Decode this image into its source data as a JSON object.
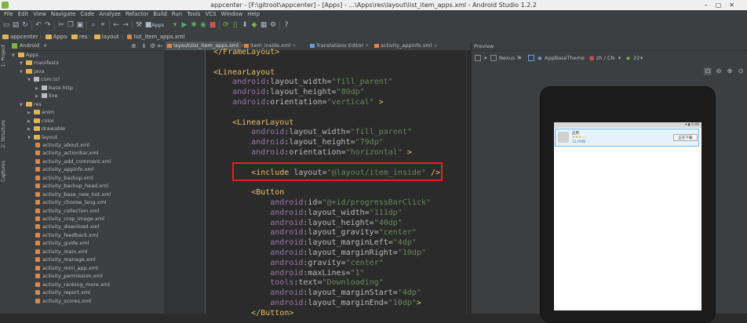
{
  "window": {
    "title": "appcenter - [F:\\gitroot\\appcenter] - [Apps] - ...\\Apps\\res\\layout\\list_item_apps.xml - Android Studio 1.2.2"
  },
  "menu": [
    "File",
    "Edit",
    "View",
    "Navigate",
    "Code",
    "Analyze",
    "Refactor",
    "Build",
    "Run",
    "Tools",
    "VCS",
    "Window",
    "Help"
  ],
  "toolbar": {
    "run_config": "Apps",
    "help": "?"
  },
  "breadcrumb": [
    "appcenter",
    "Apps",
    "res",
    "layout",
    "list_item_apps.xml"
  ],
  "left_strip": {
    "project": "1: Project",
    "structure": "2: Structure",
    "captures": "Captures"
  },
  "project_panel": {
    "view_mode": "Android",
    "tree": [
      {
        "label": "Apps",
        "level": 0,
        "type": "module"
      },
      {
        "label": "manifests",
        "level": 1,
        "type": "folder"
      },
      {
        "label": "java",
        "level": 1,
        "type": "folder"
      },
      {
        "label": "com.tcl",
        "level": 2,
        "type": "package"
      },
      {
        "label": "base.http",
        "level": 3,
        "type": "package"
      },
      {
        "label": "live",
        "level": 3,
        "type": "package"
      },
      {
        "label": "res",
        "level": 1,
        "type": "folder"
      },
      {
        "label": "anim",
        "level": 2,
        "type": "folder"
      },
      {
        "label": "color",
        "level": 2,
        "type": "folder"
      },
      {
        "label": "drawable",
        "level": 2,
        "type": "folder"
      },
      {
        "label": "layout",
        "level": 2,
        "type": "folder"
      },
      {
        "label": "activity_about.xml",
        "level": 3,
        "type": "xml"
      },
      {
        "label": "activity_actionbar.xml",
        "level": 3,
        "type": "xml"
      },
      {
        "label": "activity_add_comment.xml",
        "level": 3,
        "type": "xml"
      },
      {
        "label": "activity_appinfo.xml",
        "level": 3,
        "type": "xml"
      },
      {
        "label": "activity_backup.xml",
        "level": 3,
        "type": "xml"
      },
      {
        "label": "activity_backup_head.xml",
        "level": 3,
        "type": "xml"
      },
      {
        "label": "activity_base_new_hot.xml",
        "level": 3,
        "type": "xml"
      },
      {
        "label": "activity_choose_lang.xml",
        "level": 3,
        "type": "xml"
      },
      {
        "label": "activity_collection.xml",
        "level": 3,
        "type": "xml"
      },
      {
        "label": "activity_crop_image.xml",
        "level": 3,
        "type": "xml"
      },
      {
        "label": "activity_download.xml",
        "level": 3,
        "type": "xml"
      },
      {
        "label": "activity_feedback.xml",
        "level": 3,
        "type": "xml"
      },
      {
        "label": "activity_guide.xml",
        "level": 3,
        "type": "xml"
      },
      {
        "label": "activity_main.xml",
        "level": 3,
        "type": "xml"
      },
      {
        "label": "activity_manage.xml",
        "level": 3,
        "type": "xml"
      },
      {
        "label": "activity_mini_app.xml",
        "level": 3,
        "type": "xml"
      },
      {
        "label": "activity_permission.xml",
        "level": 3,
        "type": "xml"
      },
      {
        "label": "activity_ranking_more.xml",
        "level": 3,
        "type": "xml"
      },
      {
        "label": "activity_report.xml",
        "level": 3,
        "type": "xml"
      },
      {
        "label": "activity_scores.xml",
        "level": 3,
        "type": "xml"
      }
    ]
  },
  "editor_tabs": [
    {
      "label": "layout\\list_item_apps.xml",
      "active": true
    },
    {
      "label": "item_inside.xml",
      "active": false
    },
    {
      "label": "Translations Editor",
      "active": false
    },
    {
      "label": "activity_appinfo.xml",
      "active": false
    }
  ],
  "code_lines": [
    [
      {
        "t": "</",
        "c": "pun"
      },
      {
        "t": "FrameLayout",
        "c": "tag"
      },
      {
        "t": ">",
        "c": "pun"
      }
    ],
    [],
    [
      {
        "t": "<",
        "c": "pun"
      },
      {
        "t": "LinearLayout",
        "c": "tag"
      }
    ],
    [
      {
        "t": "    android",
        "c": "ns"
      },
      {
        "t": ":layout_width=",
        "c": "attr"
      },
      {
        "t": "\"fill_parent\"",
        "c": "val"
      }
    ],
    [
      {
        "t": "    android",
        "c": "ns"
      },
      {
        "t": ":layout_height=",
        "c": "attr"
      },
      {
        "t": "\"80dp\"",
        "c": "val"
      }
    ],
    [
      {
        "t": "    android",
        "c": "ns"
      },
      {
        "t": ":orientation=",
        "c": "attr"
      },
      {
        "t": "\"vertical\"",
        "c": "val"
      },
      {
        "t": " >",
        "c": "pun"
      }
    ],
    [],
    [
      {
        "t": "    <",
        "c": "pun"
      },
      {
        "t": "LinearLayout",
        "c": "tag"
      }
    ],
    [
      {
        "t": "        android",
        "c": "ns"
      },
      {
        "t": ":layout_width=",
        "c": "attr"
      },
      {
        "t": "\"fill_parent\"",
        "c": "val"
      }
    ],
    [
      {
        "t": "        android",
        "c": "ns"
      },
      {
        "t": ":layout_height=",
        "c": "attr"
      },
      {
        "t": "\"79dp\"",
        "c": "val"
      }
    ],
    [
      {
        "t": "        android",
        "c": "ns"
      },
      {
        "t": ":orientation=",
        "c": "attr"
      },
      {
        "t": "\"horizontal\"",
        "c": "val"
      },
      {
        "t": " >",
        "c": "pun"
      }
    ],
    [],
    [
      {
        "t": "        <",
        "c": "pun"
      },
      {
        "t": "include ",
        "c": "tag"
      },
      {
        "t": "layout=",
        "c": "attr"
      },
      {
        "t": "\"@layout/item_inside\"",
        "c": "val"
      },
      {
        "t": " />",
        "c": "pun"
      }
    ],
    [],
    [
      {
        "t": "        <",
        "c": "pun"
      },
      {
        "t": "Button",
        "c": "tag"
      }
    ],
    [
      {
        "t": "            android",
        "c": "ns"
      },
      {
        "t": ":id=",
        "c": "attr"
      },
      {
        "t": "\"@+id/progressBarClick\"",
        "c": "val"
      }
    ],
    [
      {
        "t": "            android",
        "c": "ns"
      },
      {
        "t": ":layout_width=",
        "c": "attr"
      },
      {
        "t": "\"111dp\"",
        "c": "val"
      }
    ],
    [
      {
        "t": "            android",
        "c": "ns"
      },
      {
        "t": ":layout_height=",
        "c": "attr"
      },
      {
        "t": "\"40dp\"",
        "c": "val"
      }
    ],
    [
      {
        "t": "            android",
        "c": "ns"
      },
      {
        "t": ":layout_gravity=",
        "c": "attr"
      },
      {
        "t": "\"center\"",
        "c": "val"
      }
    ],
    [
      {
        "t": "            android",
        "c": "ns"
      },
      {
        "t": ":layout_marginLeft=",
        "c": "attr"
      },
      {
        "t": "\"4dp\"",
        "c": "val"
      }
    ],
    [
      {
        "t": "            android",
        "c": "ns"
      },
      {
        "t": ":layout_marginRight=",
        "c": "attr"
      },
      {
        "t": "\"10dp\"",
        "c": "val"
      }
    ],
    [
      {
        "t": "            android",
        "c": "ns"
      },
      {
        "t": ":gravity=",
        "c": "attr"
      },
      {
        "t": "\"center\"",
        "c": "val"
      }
    ],
    [
      {
        "t": "            android",
        "c": "ns"
      },
      {
        "t": ":maxLines=",
        "c": "attr"
      },
      {
        "t": "\"1\"",
        "c": "val"
      }
    ],
    [
      {
        "t": "            tools",
        "c": "ns"
      },
      {
        "t": ":text=",
        "c": "attr"
      },
      {
        "t": "\"Downloading\"",
        "c": "val"
      }
    ],
    [
      {
        "t": "            android",
        "c": "ns"
      },
      {
        "t": ":layout_marginStart=",
        "c": "attr"
      },
      {
        "t": "\"4dp\"",
        "c": "val"
      }
    ],
    [
      {
        "t": "            android",
        "c": "ns"
      },
      {
        "t": ":layout_marginEnd=",
        "c": "attr"
      },
      {
        "t": "\"10dp\"",
        "c": "val"
      },
      {
        "t": ">",
        "c": "pun"
      }
    ],
    [
      {
        "t": "        </",
        "c": "pun"
      },
      {
        "t": "Button",
        "c": "tag"
      },
      {
        "t": ">",
        "c": "pun"
      }
    ]
  ],
  "preview": {
    "header": "Preview",
    "device": "Nexus 7",
    "theme": "AppBaseTheme",
    "locale": "zh / CN",
    "api": "22",
    "status_time": "5:00",
    "item_title": "应用",
    "item_sub1": "★★★☆☆",
    "item_sub2": "12.0MB",
    "item_button": "正在下载"
  },
  "colors": {
    "highlight_box": "#e02020",
    "editor_bg": "#2b2b2b",
    "panel_bg": "#3c3f41"
  }
}
